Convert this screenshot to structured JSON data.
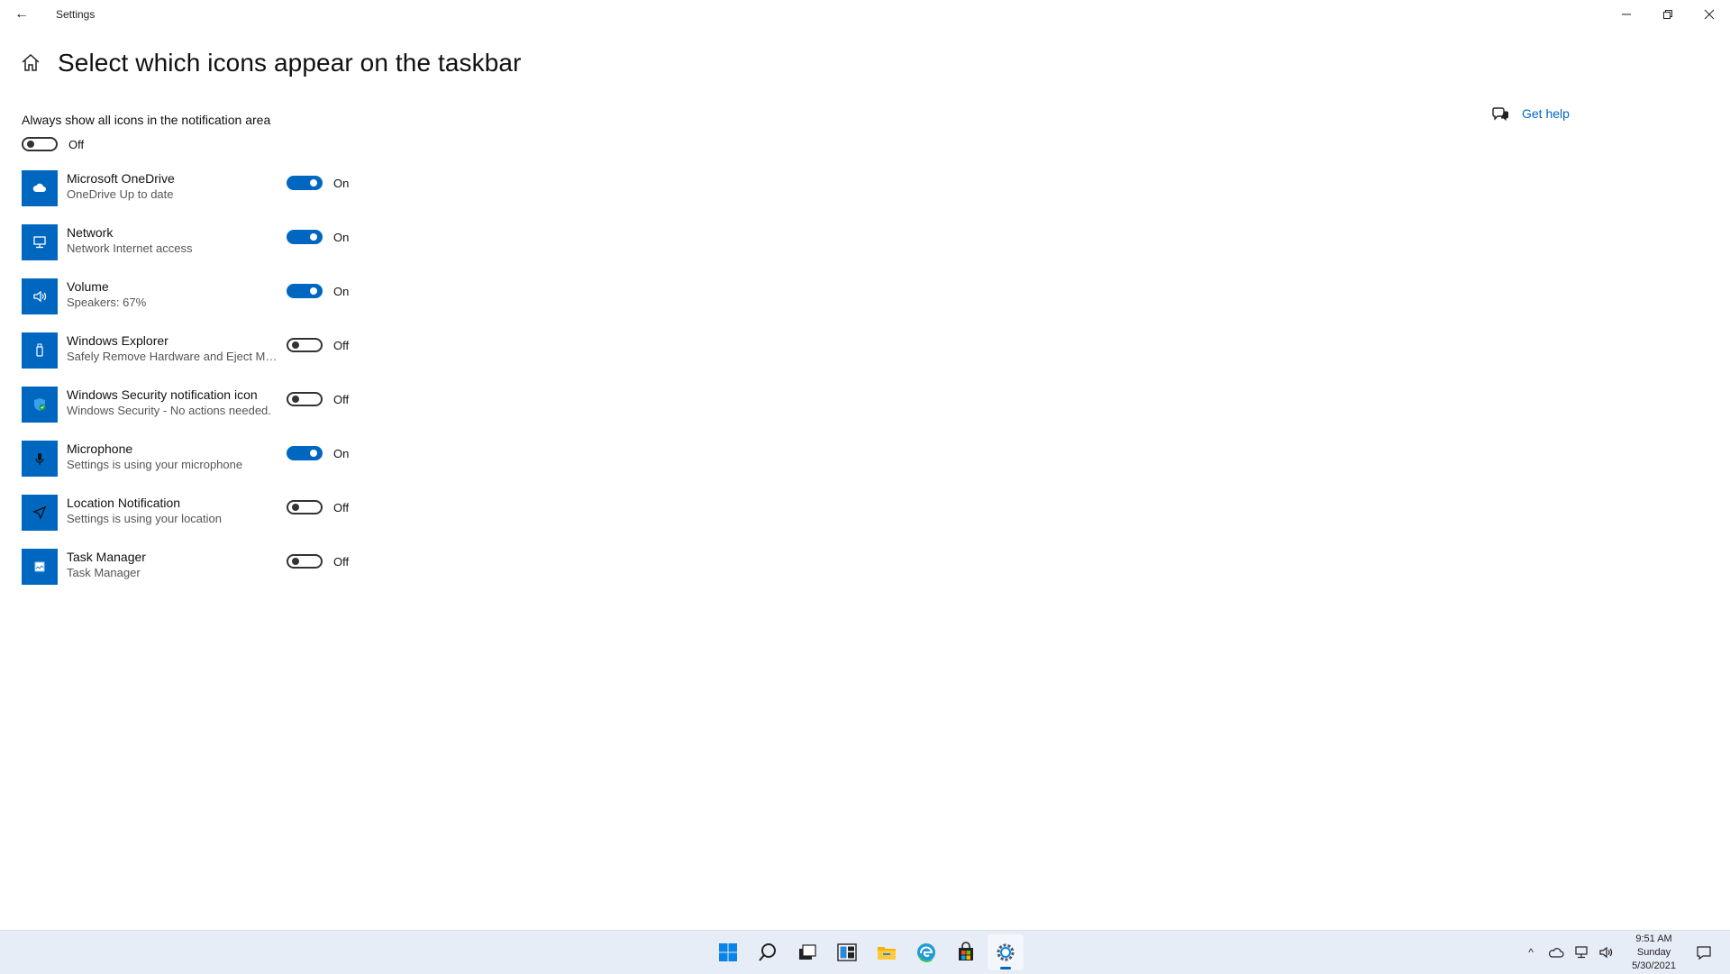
{
  "window": {
    "title": "Settings",
    "back_icon": "←",
    "controls": {
      "minimize": "—",
      "restore": "❐",
      "close": "✕"
    }
  },
  "header": {
    "title": "Select which icons appear on the taskbar"
  },
  "help": {
    "label": "Get help"
  },
  "always_show": {
    "label": "Always show all icons in the notification area",
    "state": "Off"
  },
  "items": [
    {
      "name": "Microsoft OneDrive",
      "desc": "OneDrive Up to date",
      "state": "On",
      "icon": "cloud-icon"
    },
    {
      "name": "Network",
      "desc": "Network Internet access",
      "state": "On",
      "icon": "network-icon"
    },
    {
      "name": "Volume",
      "desc": "Speakers: 67%",
      "state": "On",
      "icon": "speaker-icon"
    },
    {
      "name": "Windows Explorer",
      "desc": "Safely Remove Hardware and Eject Media",
      "state": "Off",
      "icon": "usb-icon"
    },
    {
      "name": "Windows Security notification icon",
      "desc": "Windows Security - No actions needed.",
      "state": "Off",
      "icon": "shield-icon"
    },
    {
      "name": "Microphone",
      "desc": "Settings is using your microphone",
      "state": "On",
      "icon": "microphone-icon"
    },
    {
      "name": "Location Notification",
      "desc": "Settings is using your location",
      "state": "Off",
      "icon": "location-icon"
    },
    {
      "name": "Task Manager",
      "desc": "Task Manager",
      "state": "Off",
      "icon": "task-manager-icon"
    }
  ],
  "taskbar": {
    "apps": [
      "start-icon",
      "search-icon",
      "task-view-icon",
      "widgets-icon",
      "file-explorer-icon",
      "edge-icon",
      "store-icon",
      "settings-icon"
    ],
    "tray_chevron": "^",
    "clock": {
      "time": "9:51 AM",
      "day": "Sunday",
      "date": "5/30/2021"
    }
  },
  "colors": {
    "accent": "#0067c0",
    "taskbar": "#e6edf6"
  }
}
